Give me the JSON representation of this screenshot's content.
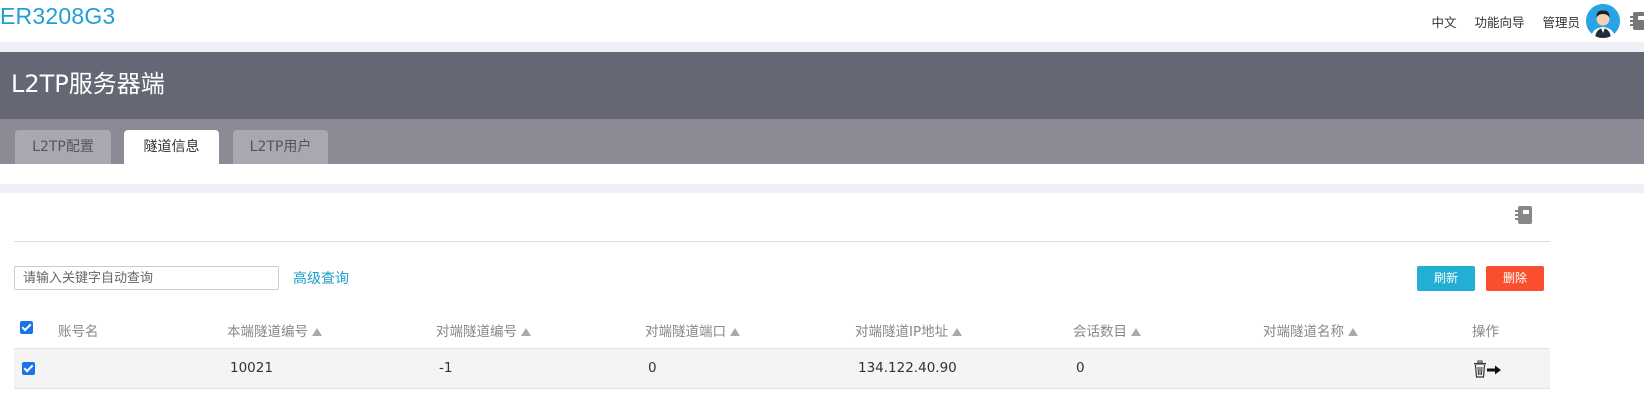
{
  "app": {
    "brand": "ER3208G3",
    "top_links": {
      "language": "中文",
      "wizard": "功能向导",
      "user": "管理员"
    }
  },
  "page": {
    "title": "L2TP服务器端",
    "tabs": [
      {
        "label": "L2TP配置",
        "active": false
      },
      {
        "label": "隧道信息",
        "active": true
      },
      {
        "label": "L2TP用户",
        "active": false
      }
    ]
  },
  "toolbar": {
    "search_placeholder": "请输入关键字自动查询",
    "advanced_label": "高级查询",
    "refresh_label": "刷新",
    "delete_label": "删除"
  },
  "table": {
    "columns": [
      "账号名",
      "本端隧道编号",
      "对端隧道编号",
      "对端隧道端口",
      "对端隧道IP地址",
      "会话数目",
      "对端隧道名称",
      "操作"
    ],
    "rows": [
      {
        "checked": true,
        "account": "",
        "local_tunnel_id": "10021",
        "peer_tunnel_id": "-1",
        "peer_tunnel_port": "0",
        "peer_tunnel_ip": "134.122.40.90",
        "session_count": "0",
        "peer_tunnel_name": ""
      }
    ]
  },
  "colors": {
    "accent": "#1f9fd6",
    "refresh": "#23aed3",
    "delete": "#fa4f2f",
    "header": "#656774"
  }
}
